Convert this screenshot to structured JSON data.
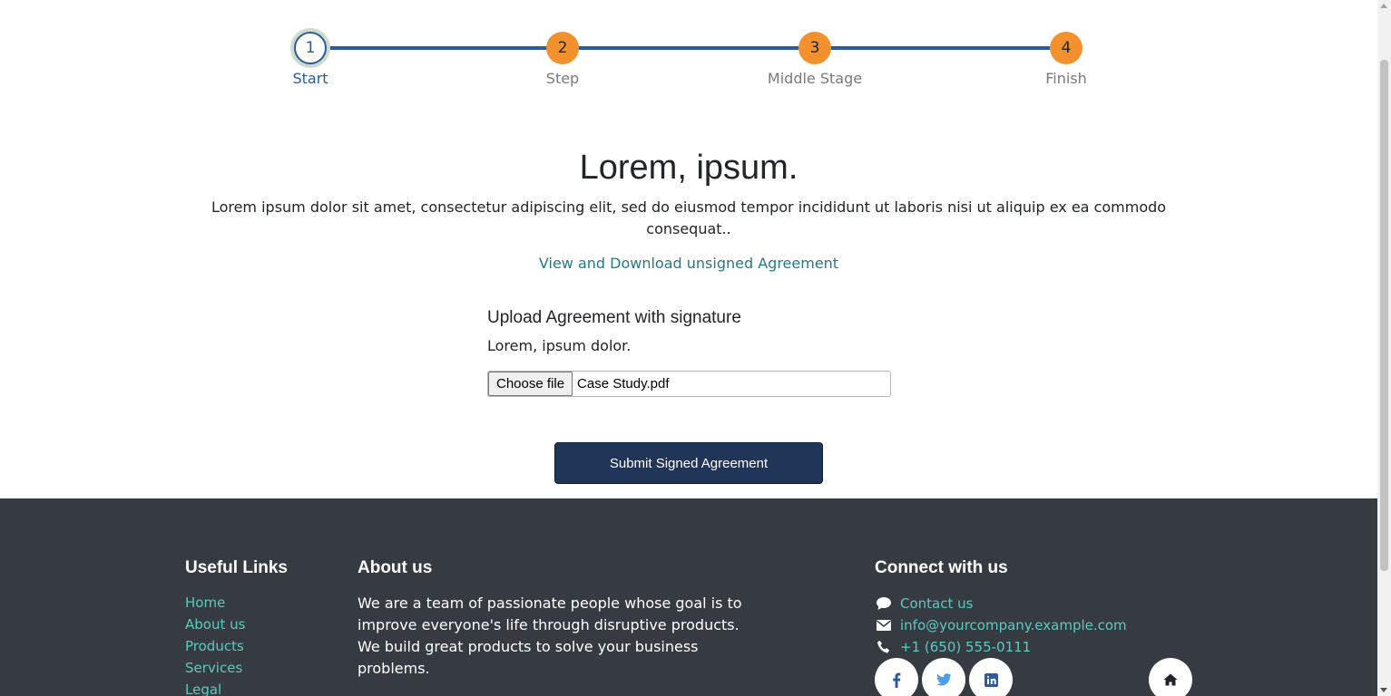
{
  "stepper": {
    "steps": [
      {
        "number": "1",
        "label": "Start",
        "state": "active"
      },
      {
        "number": "2",
        "label": "Step",
        "state": "pending"
      },
      {
        "number": "3",
        "label": "Middle Stage",
        "state": "pending"
      },
      {
        "number": "4",
        "label": "Finish",
        "state": "pending"
      }
    ],
    "colors": {
      "line": "#2a5b9b",
      "pending": "#f4912f",
      "active_ring": "#cfdccb"
    }
  },
  "main": {
    "title": "Lorem, ipsum.",
    "description": "Lorem ipsum dolor sit amet, consectetur adipiscing elit, sed do eiusmod tempor incididunt ut laboris nisi ut aliquip ex ea commodo consequat..",
    "agreement_link": "View and Download unsigned Agreement"
  },
  "upload": {
    "heading": "Upload Agreement with signature",
    "subtext": "Lorem, ipsum dolor.",
    "choose_button": "Choose file",
    "file_name": "Case Study.pdf"
  },
  "submit": {
    "label": "Submit Signed Agreement",
    "color": "#213559"
  },
  "footer": {
    "background": "#363b42",
    "links_heading": "Useful Links",
    "links": [
      "Home",
      "About us",
      "Products",
      "Services",
      "Legal"
    ],
    "about_heading": "About us",
    "about_text": "We are a team of passionate people whose goal is to improve everyone's life through disruptive products. We build great products to solve your business problems.",
    "connect_heading": "Connect with us",
    "contacts": [
      {
        "icon": "comment-icon",
        "text": "Contact us"
      },
      {
        "icon": "envelope-icon",
        "text": "info@yourcompany.example.com"
      },
      {
        "icon": "phone-icon",
        "text": "+1 (650) 555-0111"
      }
    ],
    "social": [
      "facebook-icon",
      "twitter-icon",
      "linkedin-icon"
    ],
    "home_icon": "home-icon"
  }
}
